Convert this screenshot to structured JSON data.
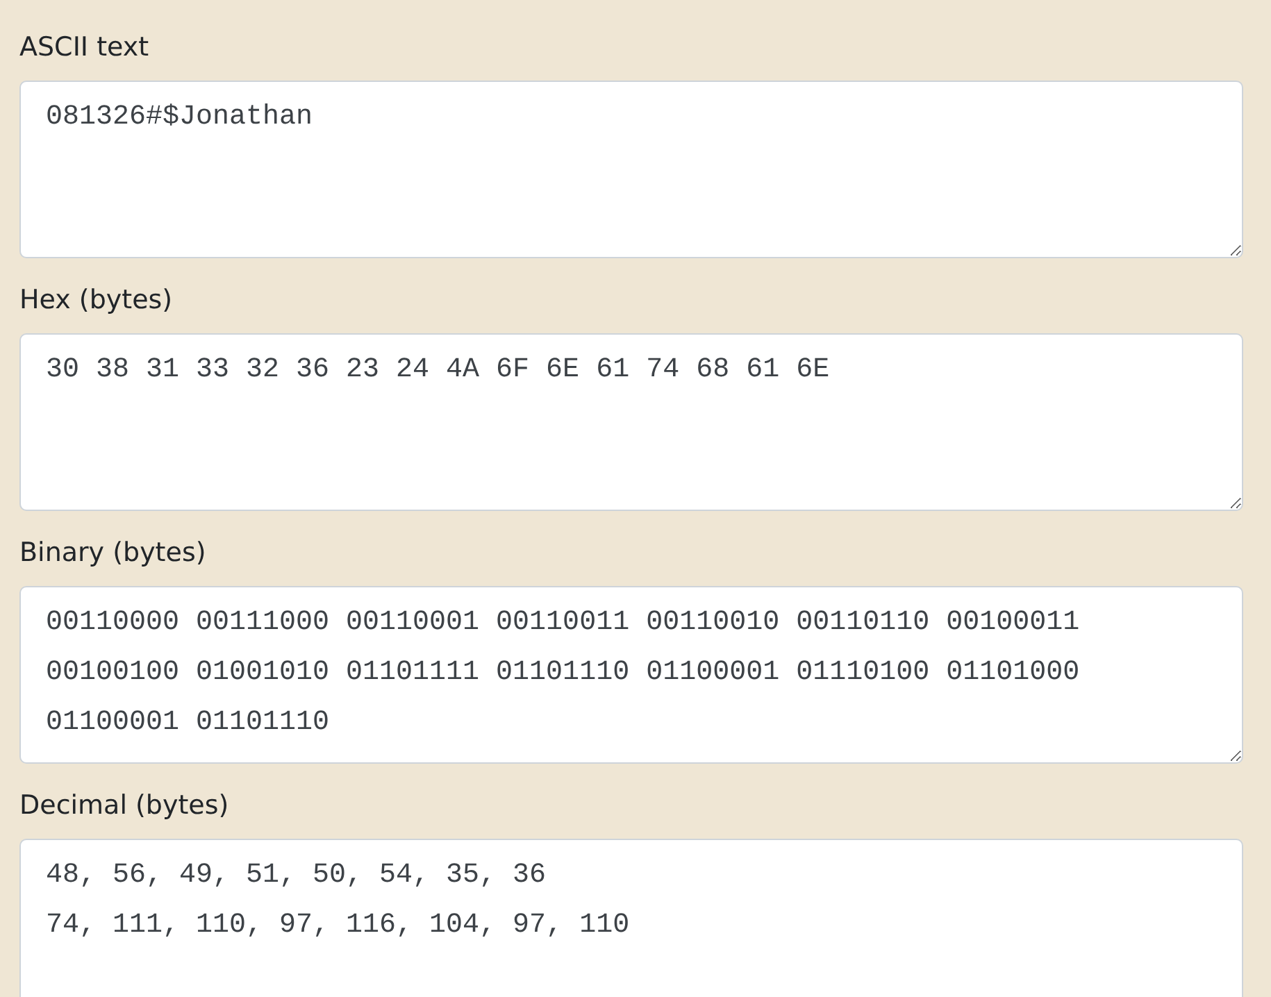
{
  "fields": [
    {
      "label": "ASCII text",
      "value": "081326#$Jonathan"
    },
    {
      "label": "Hex (bytes)",
      "value": "30 38 31 33 32 36 23 24 4A 6F 6E 61 74 68 61 6E"
    },
    {
      "label": "Binary (bytes)",
      "value": "00110000 00111000 00110001 00110011 00110010 00110110 00100011 00100100 01001010 01101111 01101110 01100001 01110100 01101000 01100001 01101110"
    },
    {
      "label": "Decimal (bytes)",
      "value": "48, 56, 49, 51, 50, 54, 35, 36\n74, 111, 110, 97, 116, 104, 97, 110"
    }
  ]
}
